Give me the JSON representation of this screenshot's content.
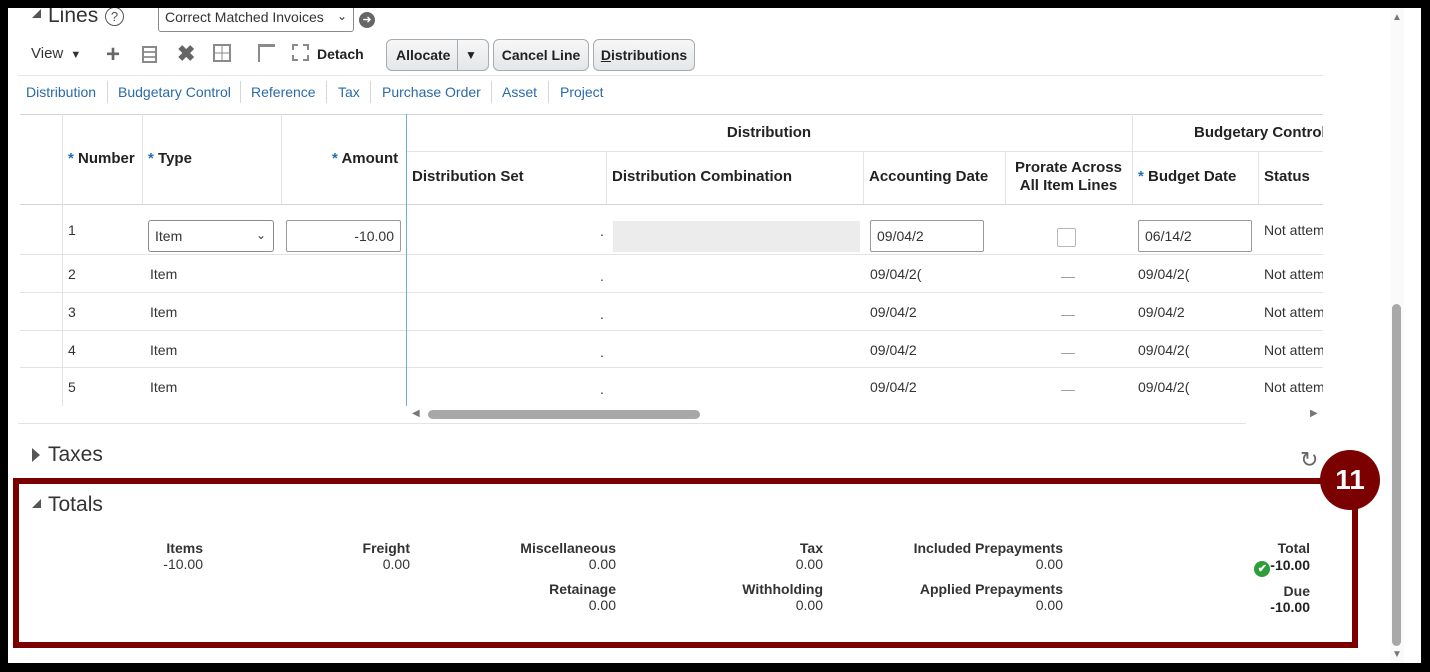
{
  "lines": {
    "title": "Lines",
    "help": "?",
    "view_select": "Correct Matched Invoices",
    "toolbar": {
      "view": "View",
      "detach": "Detach",
      "allocate": "Allocate",
      "cancel_line": "Cancel Line",
      "distributions_first": "D",
      "distributions_rest": "istributions"
    },
    "tabs": [
      "Distribution",
      "Budgetary Control",
      "Reference",
      "Tax",
      "Purchase Order",
      "Asset",
      "Project"
    ],
    "columns": {
      "number": "Number",
      "type": "Type",
      "amount": "Amount",
      "group_distribution": "Distribution",
      "group_budgetary": "Budgetary Control",
      "distribution_set": "Distribution Set",
      "distribution_combination": "Distribution Combination",
      "accounting_date": "Accounting Date",
      "prorate_line1": "Prorate Across",
      "prorate_line2": "All Item Lines",
      "budget_date": "Budget Date",
      "status": "Status"
    },
    "rows": [
      {
        "number": "1",
        "type": "Item",
        "amount": "-10.00",
        "dist_set": ".",
        "accounting_date": "09/04/2",
        "prorate": "",
        "budget_date": "06/14/2",
        "status": "Not attem"
      },
      {
        "number": "2",
        "type": "Item",
        "amount": "",
        "dist_set": ".",
        "accounting_date": "09/04/2(",
        "prorate": "—",
        "budget_date": "09/04/2(",
        "status": "Not attem"
      },
      {
        "number": "3",
        "type": "Item",
        "amount": "",
        "dist_set": ".",
        "accounting_date": "09/04/2",
        "prorate": "—",
        "budget_date": "09/04/2",
        "status": "Not attem"
      },
      {
        "number": "4",
        "type": "Item",
        "amount": "",
        "dist_set": ".",
        "accounting_date": "09/04/2",
        "prorate": "—",
        "budget_date": "09/04/2(",
        "status": "Not attem"
      },
      {
        "number": "5",
        "type": "Item",
        "amount": "",
        "dist_set": ".",
        "accounting_date": "09/04/2",
        "prorate": "—",
        "budget_date": "09/04/2(",
        "status": "Not attem"
      }
    ]
  },
  "taxes": {
    "title": "Taxes"
  },
  "totals": {
    "title": "Totals",
    "callout": "11",
    "items_label": "Items",
    "items_value": "-10.00",
    "freight_label": "Freight",
    "freight_value": "0.00",
    "misc_label": "Miscellaneous",
    "misc_value": "0.00",
    "tax_label": "Tax",
    "tax_value": "0.00",
    "included_prepay_label": "Included Prepayments",
    "included_prepay_value": "0.00",
    "total_label": "Total",
    "total_value": "-10.00",
    "retainage_label": "Retainage",
    "retainage_value": "0.00",
    "withholding_label": "Withholding",
    "withholding_value": "0.00",
    "applied_prepay_label": "Applied Prepayments",
    "applied_prepay_value": "0.00",
    "due_label": "Due",
    "due_value": "-10.00"
  },
  "colors": {
    "highlight_border": "#7b0000",
    "callout_bg": "#7b0000",
    "link": "#2a6aa8",
    "required_star": "#1f6fb2",
    "success": "#2e9e3a"
  },
  "icons": [
    "collapse-triangle-icon",
    "help-icon",
    "go-arrow-icon",
    "add-icon",
    "edit-icon",
    "delete-icon",
    "freeze-icon",
    "wrap-icon",
    "detach-icon",
    "dropdown-icon",
    "checkbox-icon",
    "expand-triangle-icon",
    "refresh-icon",
    "check-circle-icon"
  ]
}
